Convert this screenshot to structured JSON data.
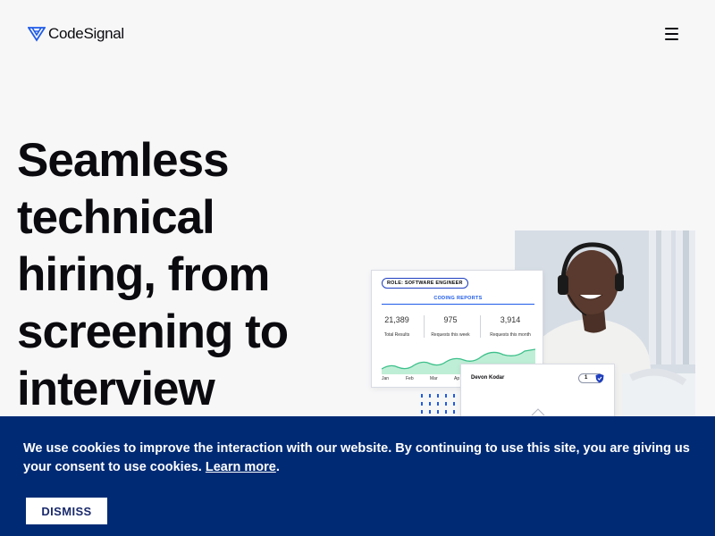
{
  "header": {
    "brand": "CodeSignal",
    "logo_icon": "codesignal-logo-icon",
    "menu_icon": "hamburger-menu-icon"
  },
  "hero": {
    "title": "Seamless technical hiring, from screening to interview"
  },
  "report_card": {
    "role": "ROLE: SOFTWARE ENGINEER",
    "heading": "CODING REPORTS",
    "stats": [
      {
        "value": "21,389",
        "label": "Total Results"
      },
      {
        "value": "975",
        "label": "Requests this week"
      },
      {
        "value": "3,914",
        "label": "Requests this month"
      }
    ],
    "months": [
      "Jan",
      "Feb",
      "Mar",
      "Ap"
    ],
    "chart_color": "#3cc08a"
  },
  "candidate_card": {
    "name": "Devon Kodar",
    "score": "1",
    "badge_icon": "shield-icon"
  },
  "cookie": {
    "message": "We use cookies to improve the interaction with our website. By continuing to use this site, you are giving us your consent to use cookies.",
    "link": "Learn more",
    "trailing": ".",
    "dismiss": "DISMISS",
    "background": "#002a74"
  }
}
